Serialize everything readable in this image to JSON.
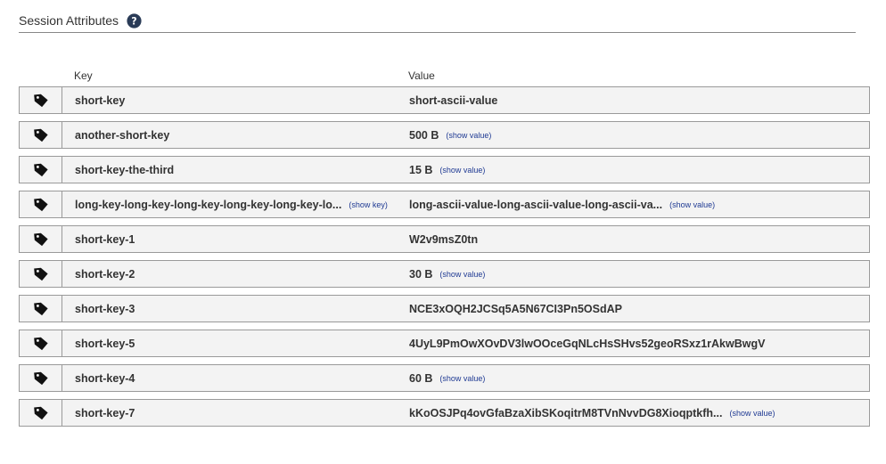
{
  "section": {
    "title": "Session Attributes"
  },
  "columns": {
    "key": "Key",
    "value": "Value"
  },
  "icons": {
    "help": "question-circle-icon",
    "row": "tag-icon"
  },
  "colors": {
    "row_background": "#f3f3f3",
    "row_border": "#9a9a9a",
    "link": "#1f3a93"
  },
  "rows": [
    {
      "key": "short-key",
      "key_link": "",
      "value": "short-ascii-value",
      "value_link": ""
    },
    {
      "key": "another-short-key",
      "key_link": "",
      "value": "500 B",
      "value_link": "(show value)"
    },
    {
      "key": "short-key-the-third",
      "key_link": "",
      "value": "15 B",
      "value_link": "(show value)"
    },
    {
      "key": "long-key-long-key-long-key-long-key-long-key-lo...",
      "key_link": "(show key)",
      "value": "long-ascii-value-long-ascii-value-long-ascii-va...",
      "value_link": "(show value)"
    },
    {
      "key": "short-key-1",
      "key_link": "",
      "value": "W2v9msZ0tn",
      "value_link": ""
    },
    {
      "key": "short-key-2",
      "key_link": "",
      "value": "30 B",
      "value_link": "(show value)"
    },
    {
      "key": "short-key-3",
      "key_link": "",
      "value": "NCE3xOQH2JCSq5A5N67CI3Pn5OSdAP",
      "value_link": ""
    },
    {
      "key": "short-key-5",
      "key_link": "",
      "value": "4UyL9PmOwXOvDV3lwOOceGqNLcHsSHvs52geoRSxz1rAkwBwgV",
      "value_link": ""
    },
    {
      "key": "short-key-4",
      "key_link": "",
      "value": "60 B",
      "value_link": "(show value)"
    },
    {
      "key": "short-key-7",
      "key_link": "",
      "value": "kKoOSJPq4ovGfaBzaXibSKoqitrM8TVnNvvDG8Xioqptkfh...",
      "value_link": "(show value)"
    }
  ]
}
